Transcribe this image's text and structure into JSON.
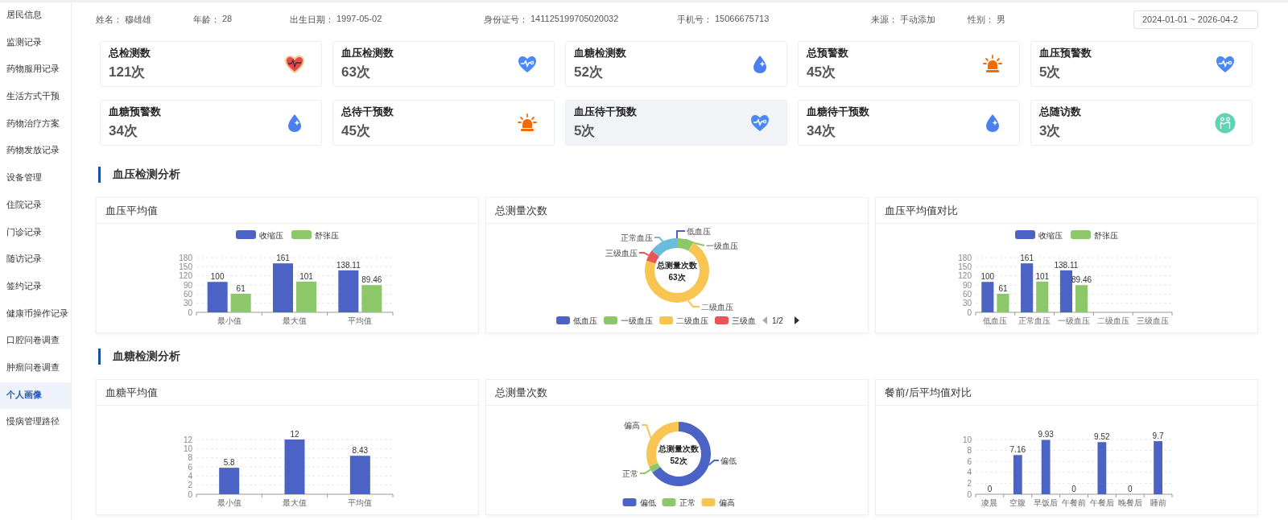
{
  "sidebar": {
    "items": [
      {
        "label": "居民信息",
        "selected": false
      },
      {
        "label": "监测记录",
        "selected": false
      },
      {
        "label": "药物服用记录",
        "selected": false
      },
      {
        "label": "生活方式干预",
        "selected": false
      },
      {
        "label": "药物治疗方案",
        "selected": false
      },
      {
        "label": "药物发放记录",
        "selected": false
      },
      {
        "label": "设备管理",
        "selected": false
      },
      {
        "label": "住院记录",
        "selected": false
      },
      {
        "label": "门诊记录",
        "selected": false
      },
      {
        "label": "随访记录",
        "selected": false
      },
      {
        "label": "签约记录",
        "selected": false
      },
      {
        "label": "健康币操作记录",
        "selected": false
      },
      {
        "label": "口腔问卷调查",
        "selected": false
      },
      {
        "label": "肿瘤问卷调查",
        "selected": false
      },
      {
        "label": "个人画像",
        "selected": true
      },
      {
        "label": "慢病管理路径",
        "selected": false
      }
    ]
  },
  "header": {
    "fields": [
      {
        "label": "姓名：",
        "value": "穆雄雄"
      },
      {
        "label": "年龄：",
        "value": "28"
      },
      {
        "label": "出生日期：",
        "value": "1997-05-02"
      },
      {
        "label": "身份证号：",
        "value": "141125199705020032"
      },
      {
        "label": "手机号：",
        "value": "15066675713"
      },
      {
        "label": "来源：",
        "value": "手动添加"
      },
      {
        "label": "性别：",
        "value": "男"
      }
    ],
    "date_range": {
      "value": "2024-01-01 ~ 2026-04-2"
    }
  },
  "stat_cards": [
    {
      "title": "总检测数",
      "value": "121次",
      "kind": "heart-rate",
      "selected": false
    },
    {
      "title": "血压检测数",
      "value": "63次",
      "kind": "heart-pulse",
      "selected": false
    },
    {
      "title": "血糖检测数",
      "value": "52次",
      "kind": "drop",
      "selected": false
    },
    {
      "title": "总预警数",
      "value": "45次",
      "kind": "alarm",
      "selected": false
    },
    {
      "title": "血压预警数",
      "value": "5次",
      "kind": "heart-pulse",
      "selected": false
    },
    {
      "title": "血糖预警数",
      "value": "34次",
      "kind": "drop",
      "selected": false
    },
    {
      "title": "总待干预数",
      "value": "45次",
      "kind": "alarm",
      "selected": false
    },
    {
      "title": "血压待干预数",
      "value": "5次",
      "kind": "heart-pulse",
      "selected": true
    },
    {
      "title": "血糖待干预数",
      "value": "34次",
      "kind": "drop",
      "selected": false
    },
    {
      "title": "总随访数",
      "value": "3次",
      "kind": "people",
      "selected": false
    }
  ],
  "sections": [
    {
      "title": "血压检测分析",
      "panels": [
        {
          "title": "血压平均值",
          "kind": "bar",
          "chart_data": {
            "type": "bar",
            "categories": [
              "最小值",
              "最大值",
              "平均值"
            ],
            "series": [
              {
                "name": "收缩压",
                "color": "#4a63c4",
                "values": [
                  100,
                  161,
                  138.11
                ]
              },
              {
                "name": "舒张压",
                "color": "#8cc86a",
                "values": [
                  61,
                  101,
                  89.46
                ]
              }
            ],
            "ylim": [
              0,
              180
            ],
            "yticks": [
              0,
              30,
              60,
              90,
              120,
              150,
              180
            ],
            "grid": true,
            "legend": true,
            "data_labels": true
          }
        },
        {
          "title": "总测量次数",
          "kind": "donut",
          "donut": {
            "center_title": "总测量次数",
            "center_value": "63次",
            "slices": [
              {
                "label": "低血压",
                "color": "#4a63c4"
              },
              {
                "label": "一级血压",
                "color": "#8cc86a"
              },
              {
                "label": "二级血压",
                "color": "#f8c452"
              },
              {
                "label": "三级血压",
                "color": "#e85555"
              },
              {
                "label": "正常血压",
                "color": "#6bbbdc"
              }
            ],
            "legend": [
              {
                "label": "低血压",
                "color": "#4a63c4"
              },
              {
                "label": "一级血压",
                "color": "#8cc86a"
              },
              {
                "label": "二级血压",
                "color": "#f8c452"
              },
              {
                "label": "三级血",
                "color": "#e85555"
              }
            ],
            "pager": {
              "text": "1/2",
              "prev_disabled": true,
              "next_disabled": false
            }
          }
        },
        {
          "title": "血压平均值对比",
          "kind": "bar",
          "chart_data": {
            "type": "bar",
            "categories": [
              "低血压",
              "正常血压",
              "一级血压",
              "二级血压",
              "三级血压"
            ],
            "series": [
              {
                "name": "收缩压",
                "color": "#4a63c4",
                "values": [
                  100,
                  161,
                  138.11,
                  null,
                  null
                ]
              },
              {
                "name": "舒张压",
                "color": "#8cc86a",
                "values": [
                  61,
                  101,
                  89.46,
                  null,
                  null
                ]
              }
            ],
            "ylim": [
              0,
              180
            ],
            "yticks": [
              0,
              30,
              60,
              90,
              120,
              150,
              180
            ],
            "grid": true,
            "legend": true,
            "data_labels": true
          }
        }
      ]
    },
    {
      "title": "血糖检测分析",
      "panels": [
        {
          "title": "血糖平均值",
          "kind": "bar",
          "chart_data": {
            "type": "bar",
            "categories": [
              "最小值",
              "最大值",
              "平均值"
            ],
            "series": [
              {
                "color": "#4a63c4",
                "values": [
                  5.8,
                  12,
                  8.43
                ]
              }
            ],
            "ylim": [
              0,
              12
            ],
            "yticks": [
              0,
              2,
              4,
              6,
              8,
              10,
              12
            ],
            "grid": true,
            "data_labels": true
          }
        },
        {
          "title": "总测量次数",
          "kind": "donut",
          "donut": {
            "center_title": "总测量次数",
            "center_value": "52次",
            "slices": [
              {
                "label": "偏低",
                "color": "#4a63c4"
              },
              {
                "label": "正常",
                "color": "#8cc86a"
              },
              {
                "label": "偏高",
                "color": "#f8c452"
              }
            ],
            "legend": [
              {
                "label": "偏低",
                "color": "#4a63c4"
              },
              {
                "label": "正常",
                "color": "#8cc86a"
              },
              {
                "label": "偏高",
                "color": "#f8c452"
              }
            ]
          }
        },
        {
          "title": "餐前/后平均值对比",
          "kind": "bar",
          "chart_data": {
            "type": "bar",
            "categories": [
              "凌晨",
              "空腹",
              "早饭后",
              "午餐前",
              "午餐后",
              "晚餐后",
              "睡前"
            ],
            "series": [
              {
                "color": "#4a63c4",
                "values": [
                  0,
                  7.16,
                  9.93,
                  0,
                  9.52,
                  0,
                  9.7
                ]
              }
            ],
            "ylim": [
              0,
              10
            ],
            "yticks": [
              0,
              2,
              4,
              6,
              8,
              10
            ],
            "grid": true,
            "data_labels": true
          }
        }
      ]
    }
  ]
}
